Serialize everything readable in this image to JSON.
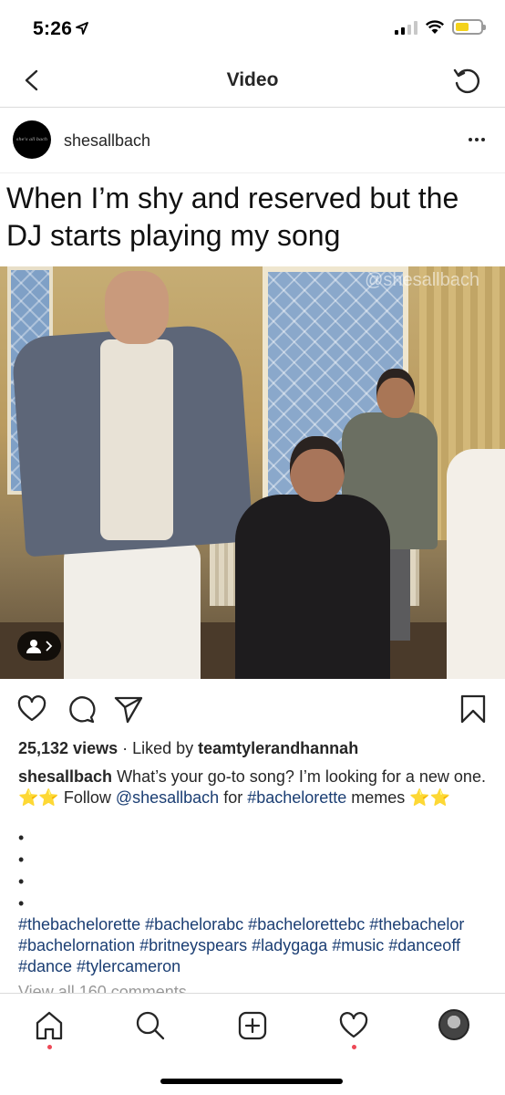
{
  "status_bar": {
    "time": "5:26",
    "location_glyph": "➤"
  },
  "nav": {
    "title": "Video"
  },
  "post": {
    "username": "shesallbach",
    "avatar_text": "she's all bach",
    "meme_caption": "When I’m shy and reserved but the DJ starts playing my song",
    "watermark": "@shesallbach",
    "views": "25,132 views",
    "liked_by_prefix": " · Liked by ",
    "liked_by_user": "teamtylerandhannah",
    "caption_user": "shesallbach",
    "caption_text_1": " What’s your go-to song? I’m looking for a new one. ⭐⭐ Follow ",
    "caption_mention": "@shesallbach",
    "caption_text_2": " for ",
    "caption_hashtag": "#bachelorette",
    "caption_text_3": " memes ⭐⭐",
    "bullets": [
      "•",
      "•",
      "•",
      "•"
    ],
    "hashtags": "#thebachelorette #bachelorabc #bachelorettebc #thebachelor #bachelornation #britneyspears #ladygaga #music #danceoff #dance #tylercameron",
    "view_comments": "View all 160 comments"
  },
  "icons": {
    "back": "chevron-left-icon",
    "refresh": "refresh-icon",
    "more": "more-options-icon",
    "like": "heart-icon",
    "comment": "comment-icon",
    "share": "paper-plane-icon",
    "save": "bookmark-icon",
    "tag": "person-tag-icon",
    "home": "home-icon",
    "search": "search-icon",
    "new_post": "add-post-icon",
    "activity": "heart-icon",
    "profile": "profile-avatar"
  },
  "colors": {
    "link": "#1b3e73",
    "notification_dot": "#ed4956",
    "battery": "#f4d21a"
  }
}
